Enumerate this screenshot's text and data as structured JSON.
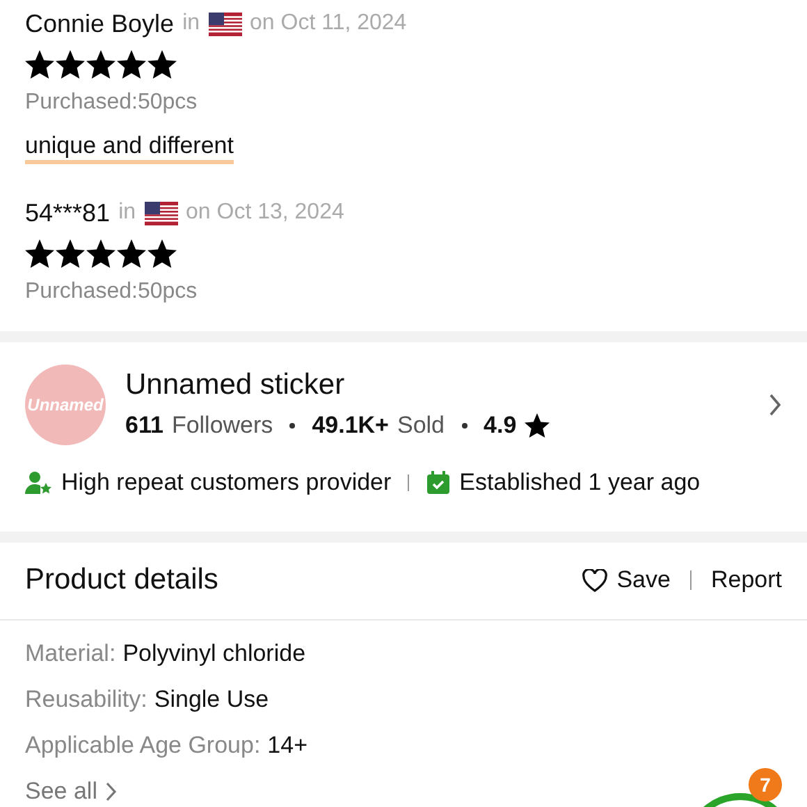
{
  "reviews": [
    {
      "author": "Connie Boyle",
      "in_label": "in",
      "date": "on Oct 11, 2024",
      "stars": 5,
      "purchased": "Purchased:50pcs",
      "comment": "unique and different"
    },
    {
      "author": "54***81",
      "in_label": "in",
      "date": "on Oct 13, 2024",
      "stars": 5,
      "purchased": "Purchased:50pcs"
    }
  ],
  "store": {
    "logo_text": "Unnamed",
    "name": "Unnamed sticker",
    "followers_count": "611",
    "followers_label": "Followers",
    "sold_count": "49.1K+",
    "sold_label": "Sold",
    "rating": "4.9",
    "badges": [
      {
        "kind": "repeat",
        "label": "High repeat customers provider"
      },
      {
        "kind": "established",
        "label": "Established 1 year ago"
      }
    ]
  },
  "product_details": {
    "title": "Product details",
    "save_label": "Save",
    "report_label": "Report",
    "attributes": [
      {
        "label": "Material:",
        "value": "Polyvinyl chloride"
      },
      {
        "label": "Reusability:",
        "value": "Single Use"
      },
      {
        "label": "Applicable Age Group:",
        "value": "14+"
      }
    ],
    "see_all": "See all"
  },
  "cart_badge": "7"
}
